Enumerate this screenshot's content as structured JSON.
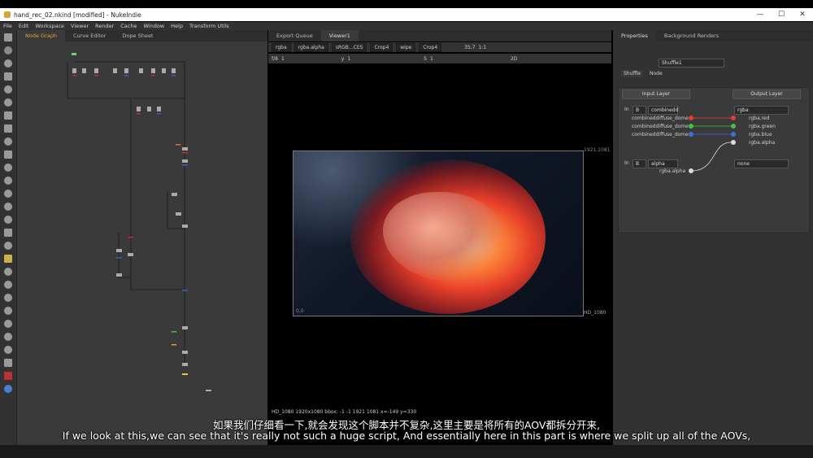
{
  "window": {
    "title": "hand_rec_02.nkind [modified] - NukeIndie",
    "minimize": "—",
    "maximize": "☐",
    "close": "✕"
  },
  "menu": [
    "File",
    "Edit",
    "Workspace",
    "Viewer",
    "Render",
    "Cache",
    "Window",
    "Help",
    "Transform Utils"
  ],
  "graph_panel": {
    "tabs": [
      "Node Graph",
      "Curve Editor",
      "Dope Sheet"
    ],
    "active_tab": 0
  },
  "viewer_panel": {
    "tabs": [
      "Export Queue",
      "Viewer1"
    ],
    "active_tab": 1,
    "toolbar1": {
      "channels": "rgba",
      "alpha": "rgba.alpha",
      "lut": "sRGB...CES",
      "a_input": "Crop4",
      "wipe": "wipe",
      "b_input": "Crop4",
      "zoom": "35.7",
      "ratio": "1:1"
    },
    "toolbar2": {
      "fstop": "f/8",
      "frame": "1",
      "y": "y",
      "y_val": "1",
      "s": "S",
      "s_val": "1",
      "mode": "2D"
    },
    "corner_top": "1921,1081",
    "corner_bottom": "HD_1080",
    "corner_origin": "0,0",
    "status": "HD_1080 1920x1080  bbox: -1 -1 1921 1081  x=-149 y=330"
  },
  "properties_panel": {
    "tabs": [
      "Properties",
      "Background Renders"
    ],
    "node_name": "Shuffle1",
    "node_tabs": [
      "Shuffle",
      "Node"
    ],
    "input_layer_label": "Input Layer",
    "output_layer_label": "Output Layer",
    "in1_label": "In",
    "in1_letter": "B",
    "in1_layer": "combinedd",
    "in1_channels": [
      "combineddiffuse_dome",
      "combineddiffuse_dome",
      "combineddiffuse_dome"
    ],
    "out1_layer": "rgba",
    "out1_channels": [
      "rgba.red",
      "rgba.green",
      "rgba.blue",
      "rgba.alpha"
    ],
    "in2_label": "In",
    "in2_letter": "B",
    "in2_layer": "alpha",
    "in2_channel": "rgba.alpha",
    "out2_layer": "none"
  },
  "subtitles": {
    "line_zh": "如果我们仔细看一下,就会发现这个脚本并不复杂,这里主要是将所有的AOV都拆分开来,",
    "line_en": "If we look at this,we can see that it's really not such a huge script, And essentially here in this part is where we split up all of the AOVs,"
  },
  "colors": {
    "red": "#e23b3b",
    "green": "#45c03e",
    "blue": "#3a72d8",
    "white": "#dddddd",
    "active_tab": "#e6a03c"
  }
}
